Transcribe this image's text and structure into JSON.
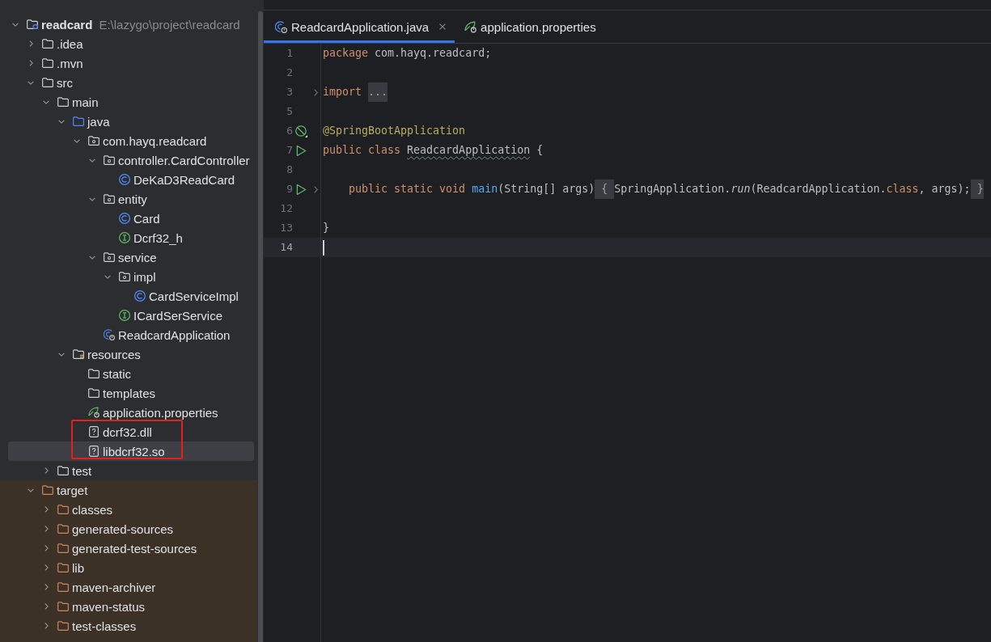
{
  "project_tree": {
    "root": {
      "label": "readcard",
      "path": "E:\\lazygo\\project\\readcard",
      "kind": "module",
      "expanded": true,
      "selected": false,
      "children": [
        {
          "label": ".idea",
          "kind": "folder",
          "expanded": false,
          "selected": false,
          "excluded": false
        },
        {
          "label": ".mvn",
          "kind": "folder",
          "expanded": false,
          "selected": false,
          "excluded": false
        },
        {
          "label": "src",
          "kind": "folder",
          "expanded": true,
          "selected": false,
          "excluded": false,
          "children": [
            {
              "label": "main",
              "kind": "folder",
              "expanded": true,
              "selected": false,
              "children": [
                {
                  "label": "java",
                  "kind": "source_folder",
                  "expanded": true,
                  "selected": false,
                  "children": [
                    {
                      "label": "com.hayq.readcard",
                      "kind": "package",
                      "expanded": true,
                      "selected": false,
                      "children": [
                        {
                          "label": "controller.CardController",
                          "kind": "package",
                          "expanded": true,
                          "selected": false,
                          "children": [
                            {
                              "label": "DeKaD3ReadCard",
                              "kind": "class",
                              "selected": false
                            }
                          ]
                        },
                        {
                          "label": "entity",
                          "kind": "package",
                          "expanded": true,
                          "selected": false,
                          "children": [
                            {
                              "label": "Card",
                              "kind": "class",
                              "selected": false
                            },
                            {
                              "label": "Dcrf32_h",
                              "kind": "interface",
                              "selected": false
                            }
                          ]
                        },
                        {
                          "label": "service",
                          "kind": "package",
                          "expanded": true,
                          "selected": false,
                          "children": [
                            {
                              "label": "impl",
                              "kind": "package",
                              "expanded": true,
                              "selected": false,
                              "children": [
                                {
                                  "label": "CardServiceImpl",
                                  "kind": "class",
                                  "selected": false
                                }
                              ]
                            },
                            {
                              "label": "ICardSerService",
                              "kind": "interface",
                              "selected": false
                            }
                          ]
                        },
                        {
                          "label": "ReadcardApplication",
                          "kind": "spring_app",
                          "selected": false
                        }
                      ]
                    }
                  ]
                },
                {
                  "label": "resources",
                  "kind": "resources_folder",
                  "expanded": true,
                  "selected": false,
                  "children": [
                    {
                      "label": "static",
                      "kind": "folder",
                      "selected": false,
                      "annotated": false
                    },
                    {
                      "label": "templates",
                      "kind": "folder",
                      "selected": false,
                      "annotated": false
                    },
                    {
                      "label": "application.properties",
                      "kind": "properties",
                      "selected": false,
                      "annotated": false
                    },
                    {
                      "label": "dcrf32.dll",
                      "kind": "unknown_file",
                      "selected": false,
                      "annotated": true
                    },
                    {
                      "label": "libdcrf32.so",
                      "kind": "unknown_file",
                      "selected": true,
                      "annotated": true
                    }
                  ]
                }
              ]
            },
            {
              "label": "test",
              "kind": "folder",
              "expanded": false,
              "selected": false
            }
          ]
        },
        {
          "label": "target",
          "kind": "folder",
          "expanded": true,
          "selected": false,
          "excluded": true,
          "children": [
            {
              "label": "classes",
              "kind": "folder",
              "expanded": false,
              "selected": false
            },
            {
              "label": "generated-sources",
              "kind": "folder",
              "expanded": false,
              "selected": false
            },
            {
              "label": "generated-test-sources",
              "kind": "folder",
              "expanded": false,
              "selected": false
            },
            {
              "label": "lib",
              "kind": "folder",
              "expanded": false,
              "selected": false
            },
            {
              "label": "maven-archiver",
              "kind": "folder",
              "expanded": false,
              "selected": false
            },
            {
              "label": "maven-status",
              "kind": "folder",
              "expanded": false,
              "selected": false
            },
            {
              "label": "test-classes",
              "kind": "folder",
              "expanded": false,
              "selected": false
            }
          ]
        }
      ]
    }
  },
  "editor": {
    "tabs": [
      {
        "label": "ReadcardApplication.java",
        "kind": "spring_app",
        "selected": true,
        "closable": true
      },
      {
        "label": "application.properties",
        "kind": "properties",
        "selected": false,
        "closable": false
      }
    ],
    "lines": [
      {
        "number": "1",
        "current": false,
        "folded": false,
        "tokens": [
          {
            "text": "package",
            "kind": "keyword"
          },
          {
            "text": " com.hayq.readcard;",
            "kind": "plain"
          }
        ]
      },
      {
        "number": "2",
        "current": false,
        "folded": false
      },
      {
        "number": "3",
        "current": false,
        "folded": true,
        "tokens": [
          {
            "text": "import ",
            "kind": "keyword"
          },
          {
            "text": "...",
            "kind": "folded"
          }
        ]
      },
      {
        "number": "5",
        "current": false,
        "folded": false
      },
      {
        "number": "6",
        "current": false,
        "folded": false,
        "gutter_marker": {
          "kind": "bean"
        },
        "tokens": [
          {
            "text": "@SpringBootApplication",
            "kind": "annotation"
          }
        ]
      },
      {
        "number": "7",
        "current": false,
        "folded": false,
        "gutter_marker": {
          "kind": "run"
        },
        "tokens": [
          {
            "text": "public class ",
            "kind": "keyword"
          },
          {
            "text": "ReadcardApplication",
            "kind": "typo"
          },
          {
            "text": " {",
            "kind": "plain"
          }
        ]
      },
      {
        "number": "8",
        "current": false,
        "folded": false
      },
      {
        "number": "9",
        "current": false,
        "folded": true,
        "gutter_marker": {
          "kind": "run"
        },
        "tokens": [
          {
            "text": "    public static void ",
            "kind": "keyword"
          },
          {
            "text": "main",
            "kind": "method"
          },
          {
            "text": "(String[] args)",
            "kind": "plain"
          },
          {
            "text": " { ",
            "kind": "folded"
          },
          {
            "text": "SpringApplication.",
            "kind": "plain"
          },
          {
            "text": "run",
            "kind": "static_call"
          },
          {
            "text": "(ReadcardApplication.",
            "kind": "plain"
          },
          {
            "text": "class",
            "kind": "keyword"
          },
          {
            "text": ", args);",
            "kind": "plain"
          },
          {
            "text": " }",
            "kind": "folded"
          }
        ]
      },
      {
        "number": "12",
        "current": false,
        "folded": false
      },
      {
        "number": "13",
        "current": false,
        "folded": false,
        "tokens": [
          {
            "text": "}",
            "kind": "plain"
          }
        ]
      },
      {
        "number": "14",
        "current": true,
        "folded": false
      }
    ]
  }
}
